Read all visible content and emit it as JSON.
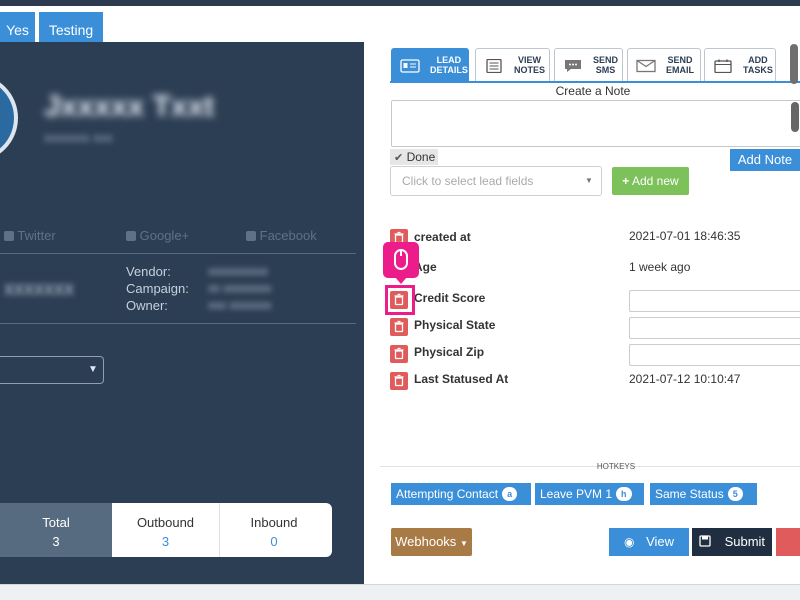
{
  "topbar": {
    "btn_yes": "Yes",
    "btn_testing": "Testing"
  },
  "lead": {
    "social": {
      "twitter": "Twitter",
      "google": "Google+",
      "facebook": "Facebook"
    },
    "meta": {
      "vendor_label": "Vendor:",
      "campaign_label": "Campaign:",
      "owner_label": "Owner:"
    },
    "stats": {
      "total_label": "Total",
      "total_value": "3",
      "outbound_label": "Outbound",
      "outbound_value": "3",
      "inbound_label": "Inbound",
      "inbound_value": "0"
    }
  },
  "tabs": [
    {
      "line1": "LEAD",
      "line2": "DETAILS"
    },
    {
      "line1": "VIEW",
      "line2": "NOTES"
    },
    {
      "line1": "SEND",
      "line2": "SMS"
    },
    {
      "line1": "SEND",
      "line2": "EMAIL"
    },
    {
      "line1": "ADD",
      "line2": "TASKS"
    }
  ],
  "notes": {
    "title": "Create a Note",
    "done_label": "Done",
    "add_note_label": "Add Note"
  },
  "fields_select": {
    "placeholder": "Click to select lead fields",
    "add_new_label": "Add new"
  },
  "fields": [
    {
      "name": "created at",
      "value": "2021-07-01 18:46:35"
    },
    {
      "name": "Age",
      "value": "1 week ago"
    },
    {
      "name": "Credit Score",
      "value": ""
    },
    {
      "name": "Physical State",
      "value": ""
    },
    {
      "name": "Physical Zip",
      "value": ""
    },
    {
      "name": "Last Statused At",
      "value": "2021-07-12 10:10:47"
    }
  ],
  "hotkeys": {
    "title": "HOTKEYS",
    "items": [
      {
        "label": "Attempting Contact",
        "key": "a"
      },
      {
        "label": "Leave PVM 1",
        "key": "h"
      },
      {
        "label": "Same Status",
        "key": "5"
      }
    ]
  },
  "actions": {
    "webhooks_label": "Webhooks",
    "view_label": "View",
    "submit_label": "Submit"
  },
  "colors": {
    "primary": "#3a8fd8",
    "sidebar": "#2c3e54",
    "danger": "#e05c5c",
    "success": "#7cc15a",
    "highlight": "#ec1c8a"
  }
}
